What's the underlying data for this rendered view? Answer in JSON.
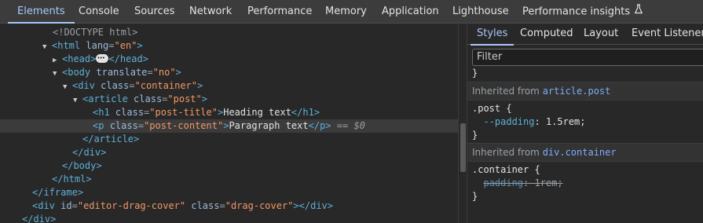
{
  "topbar": {
    "tabs": [
      "Elements",
      "Console",
      "Sources",
      "Network",
      "Performance",
      "Memory",
      "Application",
      "Lighthouse",
      "Performance insights"
    ],
    "active_index": 0,
    "experimental_icon": "flask-icon"
  },
  "dom": {
    "doctype": "<!DOCTYPE html>",
    "html_tag": "html",
    "html_lang_attr": "lang",
    "html_lang_val": "\"en\"",
    "head_tag": "head",
    "body_tag": "body",
    "body_attr": "translate",
    "body_val": "\"no\"",
    "div_tag": "div",
    "class_attr": "class",
    "div_class": "\"container\"",
    "article_tag": "article",
    "article_class": "\"post\"",
    "h1_tag": "h1",
    "h1_class": "\"post-title\"",
    "h1_text": "Heading text",
    "p_tag": "p",
    "p_class": "\"post-content\"",
    "p_text": "Paragraph text",
    "selected_marker": "== $0",
    "iframe_tag": "iframe",
    "cover_id_attr": "id",
    "cover_id": "\"editor-drag-cover\"",
    "cover_class": "\"drag-cover\""
  },
  "styles_panel": {
    "subtabs": [
      "Styles",
      "Computed",
      "Layout",
      "Event Listeners"
    ],
    "active_index": 0,
    "filter_placeholder": "Filter",
    "closing_brace": "}",
    "inherited_label": "Inherited from",
    "section1": {
      "source": "article.post",
      "selector": ".post {",
      "prop": "--padding",
      "value": "1.5rem;",
      "close": "}"
    },
    "section2": {
      "source": "div.container",
      "selector": ".container {",
      "prop": "padding",
      "value": "1rem;",
      "overridden": true,
      "close": "}"
    }
  },
  "colors": {
    "accent": "#a8c7fa",
    "tag": "#5db0d7",
    "attr_name": "#9bbbdc",
    "attr_value": "#f29766",
    "background": "#282828",
    "toolbar": "#3c3c3c"
  }
}
